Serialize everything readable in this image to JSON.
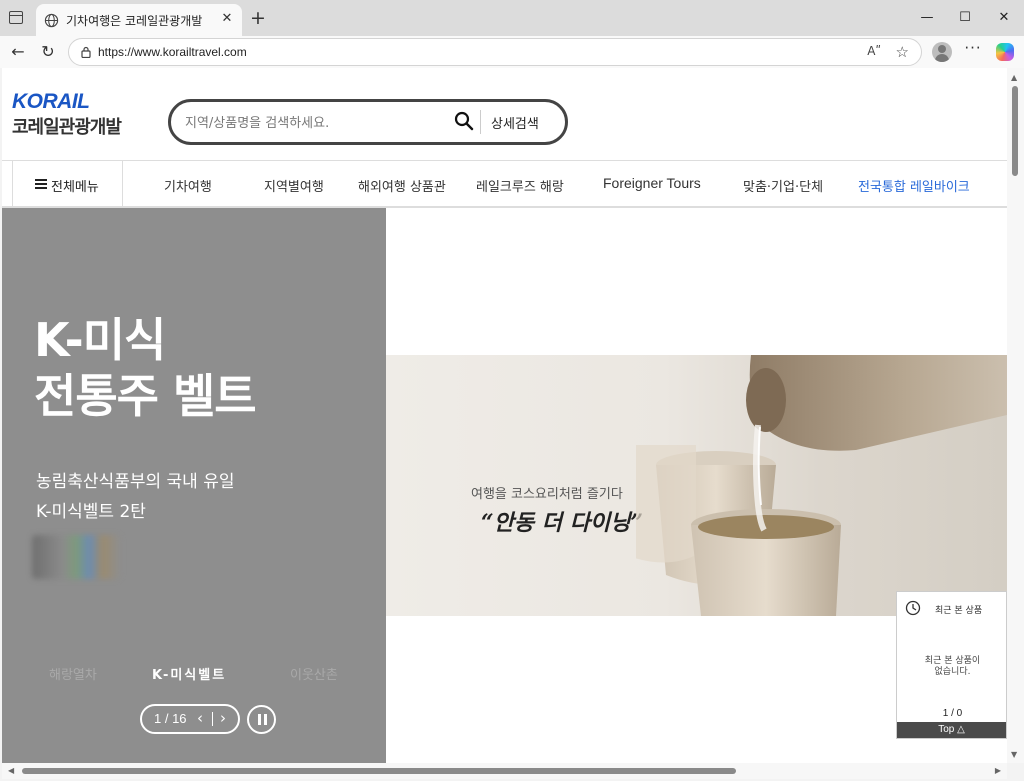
{
  "browser": {
    "tab_title": "기차여행은 코레일관광개발",
    "url": "https://www.korailtravel.com",
    "read_aloud_label": "Aʺ",
    "tab_close_glyph": "✕",
    "new_tab_glyph": "+",
    "window_buttons": {
      "minimize": "—",
      "maximize": "☐",
      "close": "✕"
    },
    "nav": {
      "back": "←",
      "reload": "↻"
    },
    "favorite_glyph": "☆",
    "more_glyph": "···"
  },
  "header": {
    "logo_en": "KORAIL",
    "logo_ko": "코레일관광개발",
    "search_placeholder": "지역/상품명을 검색하세요.",
    "advanced_search": "상세검색"
  },
  "gnb": {
    "all_menu": "전체메뉴",
    "items": [
      "기차여행",
      "지역별여행",
      "해외여행 상품관",
      "레일크루즈 해랑",
      "Foreigner Tours",
      "맞춤·기업·단체",
      "전국통합 레일바이크"
    ]
  },
  "hero": {
    "title_line1": "K-미식",
    "title_line2": "전통주 벨트",
    "sub_line1": "농림축산식품부의 국내 유일",
    "sub_line2": "K-미식벨트 2탄",
    "tabs": [
      "해랑열차",
      "K-미식벨트",
      "이웃산촌"
    ],
    "active_tab": "K-미식벨트",
    "pager_count": "1 / 16",
    "pager_prev": "‹",
    "pager_next": "›"
  },
  "banner": {
    "caption": "여행을 코스요리처럼 즐기다",
    "headline": "“안동 더 다이닝”"
  },
  "recent_widget": {
    "title": "최근 본 상품",
    "empty_line1": "최근 본 상품이",
    "empty_line2": "없습니다.",
    "count": "1 / 0",
    "top_button": "Top △"
  },
  "colors": {
    "brand_blue": "#1a56c4",
    "gnb_highlight": "#2a6ad9",
    "hero_bg": "#8e8e8e"
  }
}
